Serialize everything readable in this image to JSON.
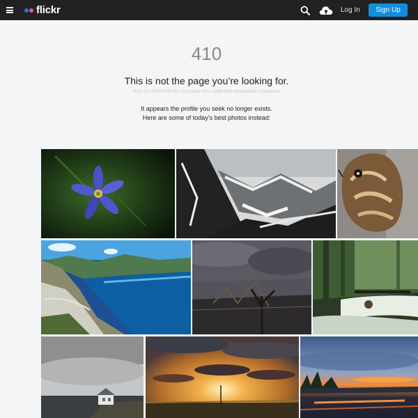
{
  "header": {
    "brand": "flickr",
    "login_label": "Log In",
    "signup_label": "Sign Up"
  },
  "icons": [
    "menu-icon",
    "flickr-logo-dots",
    "search-icon",
    "upload-cloud-icon"
  ],
  "error": {
    "code": "410",
    "title": "This is not the page you’re looking for.",
    "request_id": "2022-07-29T06:09:03Z-d1c61bd4-6f1c-43d9-bf58-b9aedab6612bdiserver",
    "message_line1": "It appears the profile you seek no longer exists.",
    "message_line2": "Here are some of today’s best photos instead:"
  },
  "colors": {
    "topbar": "#212124",
    "signup_button": "#128fdc",
    "logo_blue": "#1d7ee0",
    "logo_pink": "#f0569b",
    "page_background": "#f3f5f6"
  }
}
